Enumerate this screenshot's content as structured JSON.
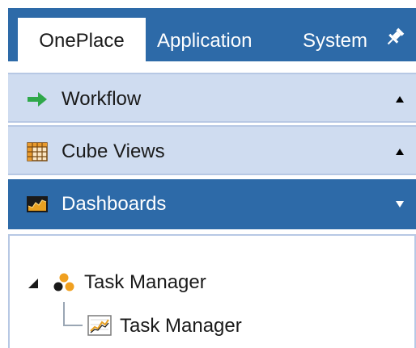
{
  "tabs": [
    {
      "label": "OnePlace",
      "active": true
    },
    {
      "label": "Application",
      "active": false
    },
    {
      "label": "System",
      "active": false
    }
  ],
  "accordion": [
    {
      "label": "Workflow",
      "icon": "arrow-right-icon",
      "state": "collapsed"
    },
    {
      "label": "Cube Views",
      "icon": "grid-table-icon",
      "state": "collapsed"
    },
    {
      "label": "Dashboards",
      "icon": "dashboard-chart-icon",
      "state": "expanded"
    }
  ],
  "tree": {
    "root": {
      "label": "Task Manager",
      "icon": "group-people-icon",
      "expanded": true
    },
    "child": {
      "label": "Task Manager",
      "icon": "line-chart-icon"
    }
  },
  "colors": {
    "accent": "#2d6aa8",
    "header_light": "#cfdcf0",
    "workflow_arrow": "#2fa84a",
    "group_icon": "#f0a020"
  }
}
